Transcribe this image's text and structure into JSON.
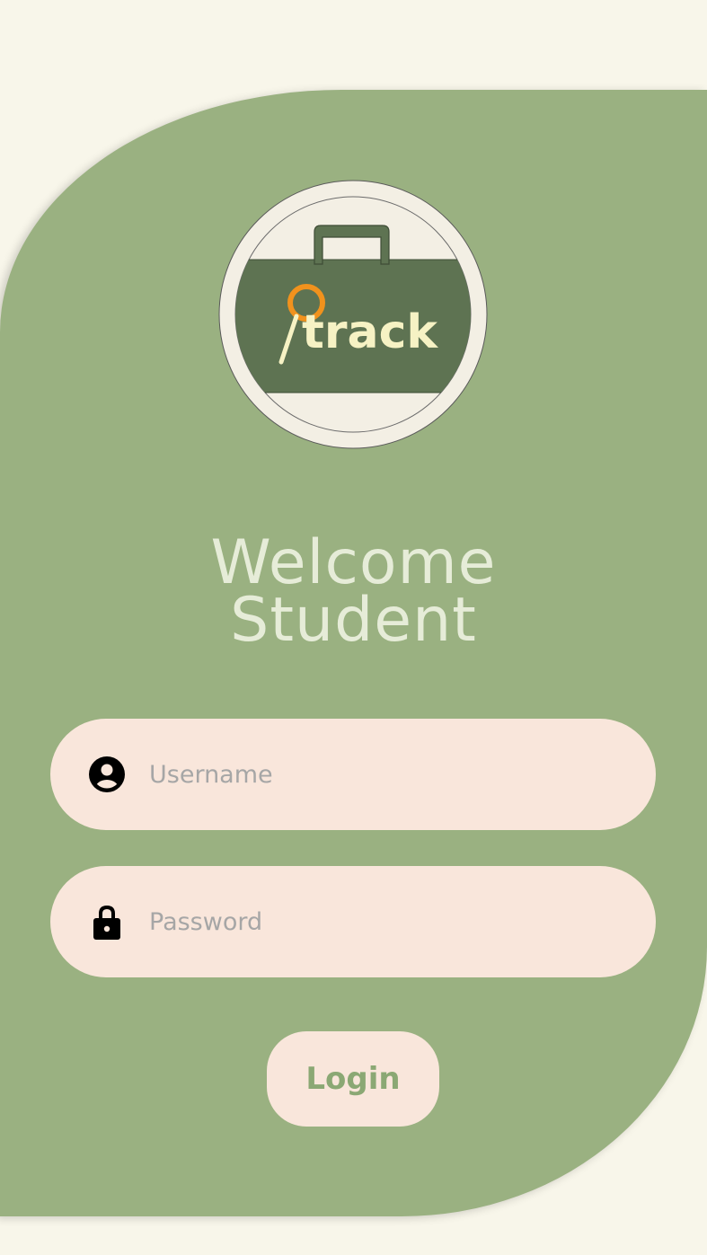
{
  "app": {
    "logo_text": "track"
  },
  "welcome": {
    "line1": "Welcome",
    "line2": "Student"
  },
  "username": {
    "placeholder": "Username",
    "value": "",
    "icon": "account-circle-icon"
  },
  "password": {
    "placeholder": "Password",
    "value": "",
    "icon": "lock-icon"
  },
  "login": {
    "label": "Login"
  },
  "colors": {
    "background": "#f8f6ea",
    "panel": "#9ab181",
    "field": "#f9e6db",
    "logo_bag": "#5e7352",
    "logo_ring": "#f3efe4",
    "logo_accent": "#f1921d",
    "welcome_text": "#e6ecd8",
    "button_text": "#8ba874"
  }
}
